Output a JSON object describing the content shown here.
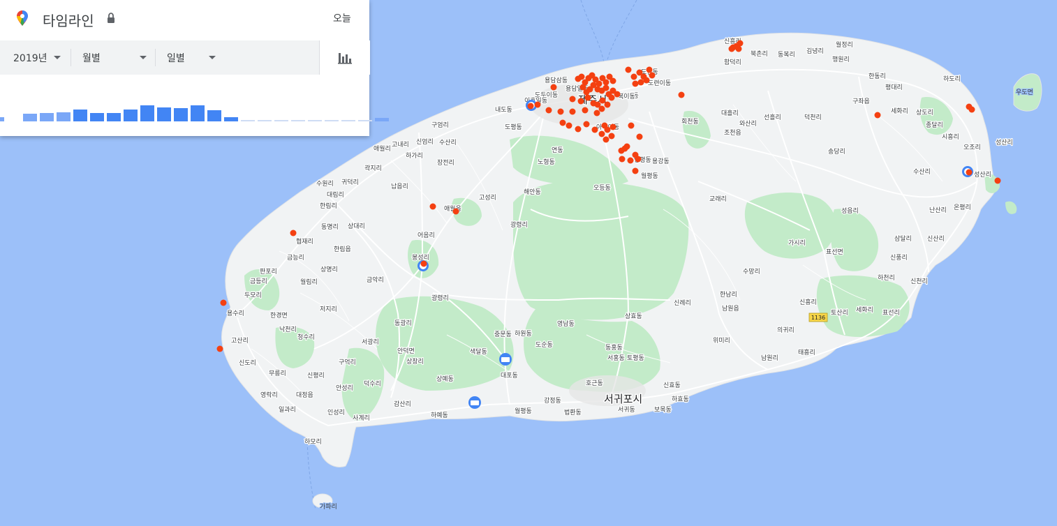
{
  "panel": {
    "title": "타임라인",
    "today_label": "오늘",
    "year_filter": "2019년",
    "period_filter": "월별",
    "day_filter": "일별",
    "chart_bars_percent": [
      6,
      11,
      12,
      13,
      17,
      12,
      12,
      17,
      23,
      20,
      19,
      23,
      16,
      6,
      2,
      1,
      2,
      2,
      1,
      1,
      2,
      2,
      5
    ]
  },
  "map": {
    "city_labels": [
      "제주시",
      "서귀포시"
    ],
    "road_shield": "1136",
    "place_labels": [
      "신흥리",
      "월정리",
      "북촌리",
      "동복리",
      "김녕리",
      "함덕리",
      "행원리",
      "한동리",
      "평대리",
      "하도리",
      "우도면",
      "구좌읍",
      "세화리",
      "상도리",
      "종달리",
      "시흥리",
      "오조리",
      "성산리",
      "수산리",
      "성산리",
      "난산리",
      "온평리",
      "성읍리",
      "삼달리",
      "신산리",
      "신풍리",
      "하천리",
      "신천리",
      "표선리",
      "세화리",
      "토산리",
      "표선면",
      "가시리",
      "교래리",
      "수망리",
      "한남리",
      "남원읍",
      "신례리",
      "위미리",
      "의귀리",
      "신흥리",
      "태흥리",
      "남원리",
      "용담삼동",
      "용담일동",
      "도두이동",
      "이호일동",
      "내도동",
      "도평동",
      "도련이동",
      "회천동",
      "대흘리",
      "와산리",
      "선흘리",
      "덕천리",
      "조천읍",
      "송당리",
      "도련동",
      "봉개동",
      "아라이동",
      "영평동",
      "용강동",
      "월평동",
      "오등동",
      "연동",
      "노형동",
      "해안동",
      "구엄리",
      "고내리",
      "애월리",
      "신엄리",
      "수산리",
      "하가리",
      "장전리",
      "곽지리",
      "수원리",
      "귀덕리",
      "대림리",
      "한림리",
      "납읍리",
      "고성리",
      "애월읍",
      "동명리",
      "상대리",
      "어음리",
      "광령리",
      "협재리",
      "금능리",
      "한림읍",
      "판포리",
      "상명리",
      "봉성리",
      "금등리",
      "월림리",
      "두모리",
      "금악리",
      "광령리",
      "용수리",
      "한경면",
      "저지리",
      "낙천리",
      "동광리",
      "고산리",
      "청수리",
      "서광리",
      "안덕면",
      "상창리",
      "구억리",
      "신도리",
      "무릉리",
      "신평리",
      "덕수리",
      "영락리",
      "대정읍",
      "안성리",
      "감산리",
      "일과리",
      "인성리",
      "사계리",
      "하모리",
      "가파리",
      "상예동",
      "하예동",
      "색달동",
      "중문동",
      "하원동",
      "도순동",
      "대포동",
      "영남동",
      "상효동",
      "동홍동",
      "서홍동",
      "토평동",
      "호근동",
      "강정동",
      "법환동",
      "월평동",
      "서귀동",
      "신효동",
      "하효동",
      "보목동",
      "북이동"
    ]
  },
  "colors": {
    "sea": "#9cc0f9",
    "land": "#f1f3f4",
    "green": "#c3ebc9",
    "road": "#ffffff",
    "point": "#f44011",
    "accent": "#4285f4"
  }
}
